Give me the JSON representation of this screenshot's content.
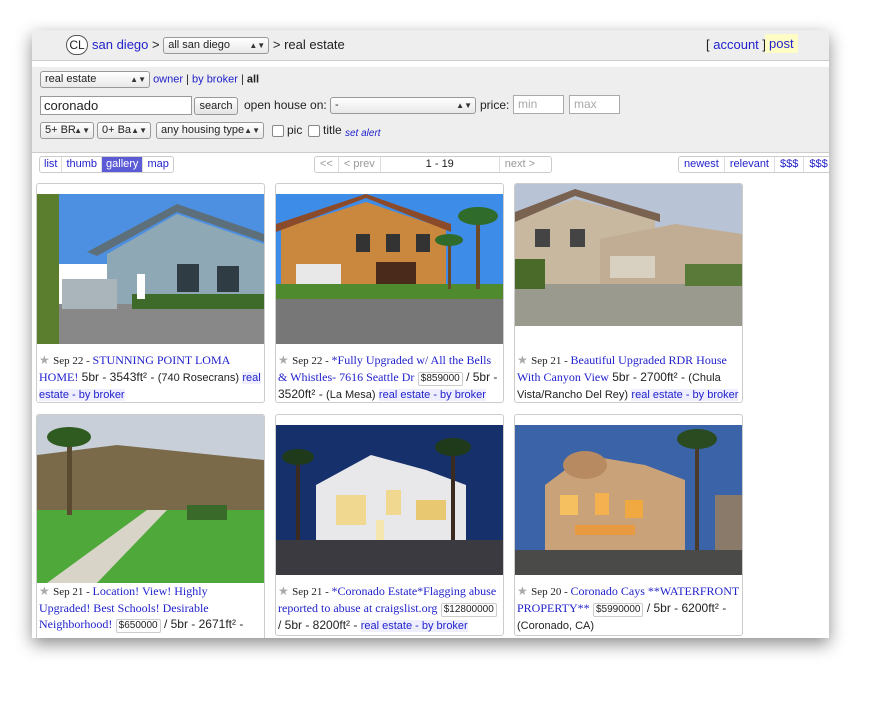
{
  "header": {
    "logo": "CL",
    "city": "san diego",
    "sep1": ">",
    "area_select": "all san diego",
    "sep2": "> real estate",
    "account_open": "[",
    "account": "account",
    "account_close": "]",
    "post": "post"
  },
  "search": {
    "category": "real estate",
    "filter_owner": "owner",
    "filter_broker": "by broker",
    "filter_all": "all",
    "query": "coronado",
    "search_button": "search",
    "open_house_label": "open house on:",
    "open_house_value": "-",
    "price_label": "price:",
    "min_placeholder": "min",
    "max_placeholder": "max",
    "bedrooms": "5+ BR",
    "bathrooms": "0+ Ba",
    "housing_type": "any housing type",
    "pic_label": "pic",
    "title_label": "title",
    "set_alert": "set alert"
  },
  "view_tabs": [
    "list",
    "thumb",
    "gallery",
    "map"
  ],
  "active_view": "gallery",
  "pager": {
    "first": "<<",
    "prev": "< prev",
    "range": "1 - 19",
    "next": "next >"
  },
  "sort": [
    "newest",
    "relevant",
    "$$$",
    "$$$"
  ],
  "sort_labels": {
    "newest": "newest",
    "relevant": "relevant",
    "high": "$$$",
    "low": "$$$"
  },
  "listings": [
    {
      "date": "Sep 22",
      "title": "STUNNING POINT LOMA HOME!",
      "price": "",
      "details": "5br - 3543ft² -",
      "hood": "(740 Rosecrans)",
      "category": "real estate - by broker",
      "image": "house-blue-siding"
    },
    {
      "date": "Sep 22",
      "title": "*Fully Upgraded w/ All the Bells & Whistles- 7616 Seattle Dr",
      "price": "$859000",
      "details": "/ 5br - 3520ft² -",
      "hood": "(La Mesa)",
      "category": "real estate - by broker",
      "image": "house-tan-palms"
    },
    {
      "date": "Sep 21",
      "title": "Beautiful Upgraded RDR House With Canyon View",
      "price": "",
      "details": "5br - 2700ft² -",
      "hood": "(Chula Vista/Rancho Del Rey)",
      "category": "real estate - by broker",
      "image": "house-stucco-garage"
    },
    {
      "date": "Sep 21",
      "title": "Location! View! Highly Upgraded! Best Schools! Desirable Neighborhood!",
      "price": "$650000",
      "details": "/ 5br - 2671ft² -",
      "hood": "",
      "category": "",
      "image": "yard-view"
    },
    {
      "date": "Sep 21",
      "title": "*Coronado Estate*Flagging abuse reported to abuse at craigslist.org",
      "price": "$12800000",
      "details": "/ 5br - 8200ft² -",
      "hood": "",
      "category": "real estate - by broker",
      "image": "modern-white-night"
    },
    {
      "date": "Sep 20",
      "title": "Coronado Cays **WATERFRONT PROPERTY**",
      "price": "$5990000",
      "details": "/ 5br - 6200ft² -",
      "hood": "(Coronado, CA)",
      "category": "",
      "image": "villa-dusk-palms"
    }
  ],
  "colors": {
    "link": "#2222cc",
    "active_tab": "#5b5bd6",
    "post_bg": "#fffdc6",
    "bar_bg": "#eeeeee"
  }
}
